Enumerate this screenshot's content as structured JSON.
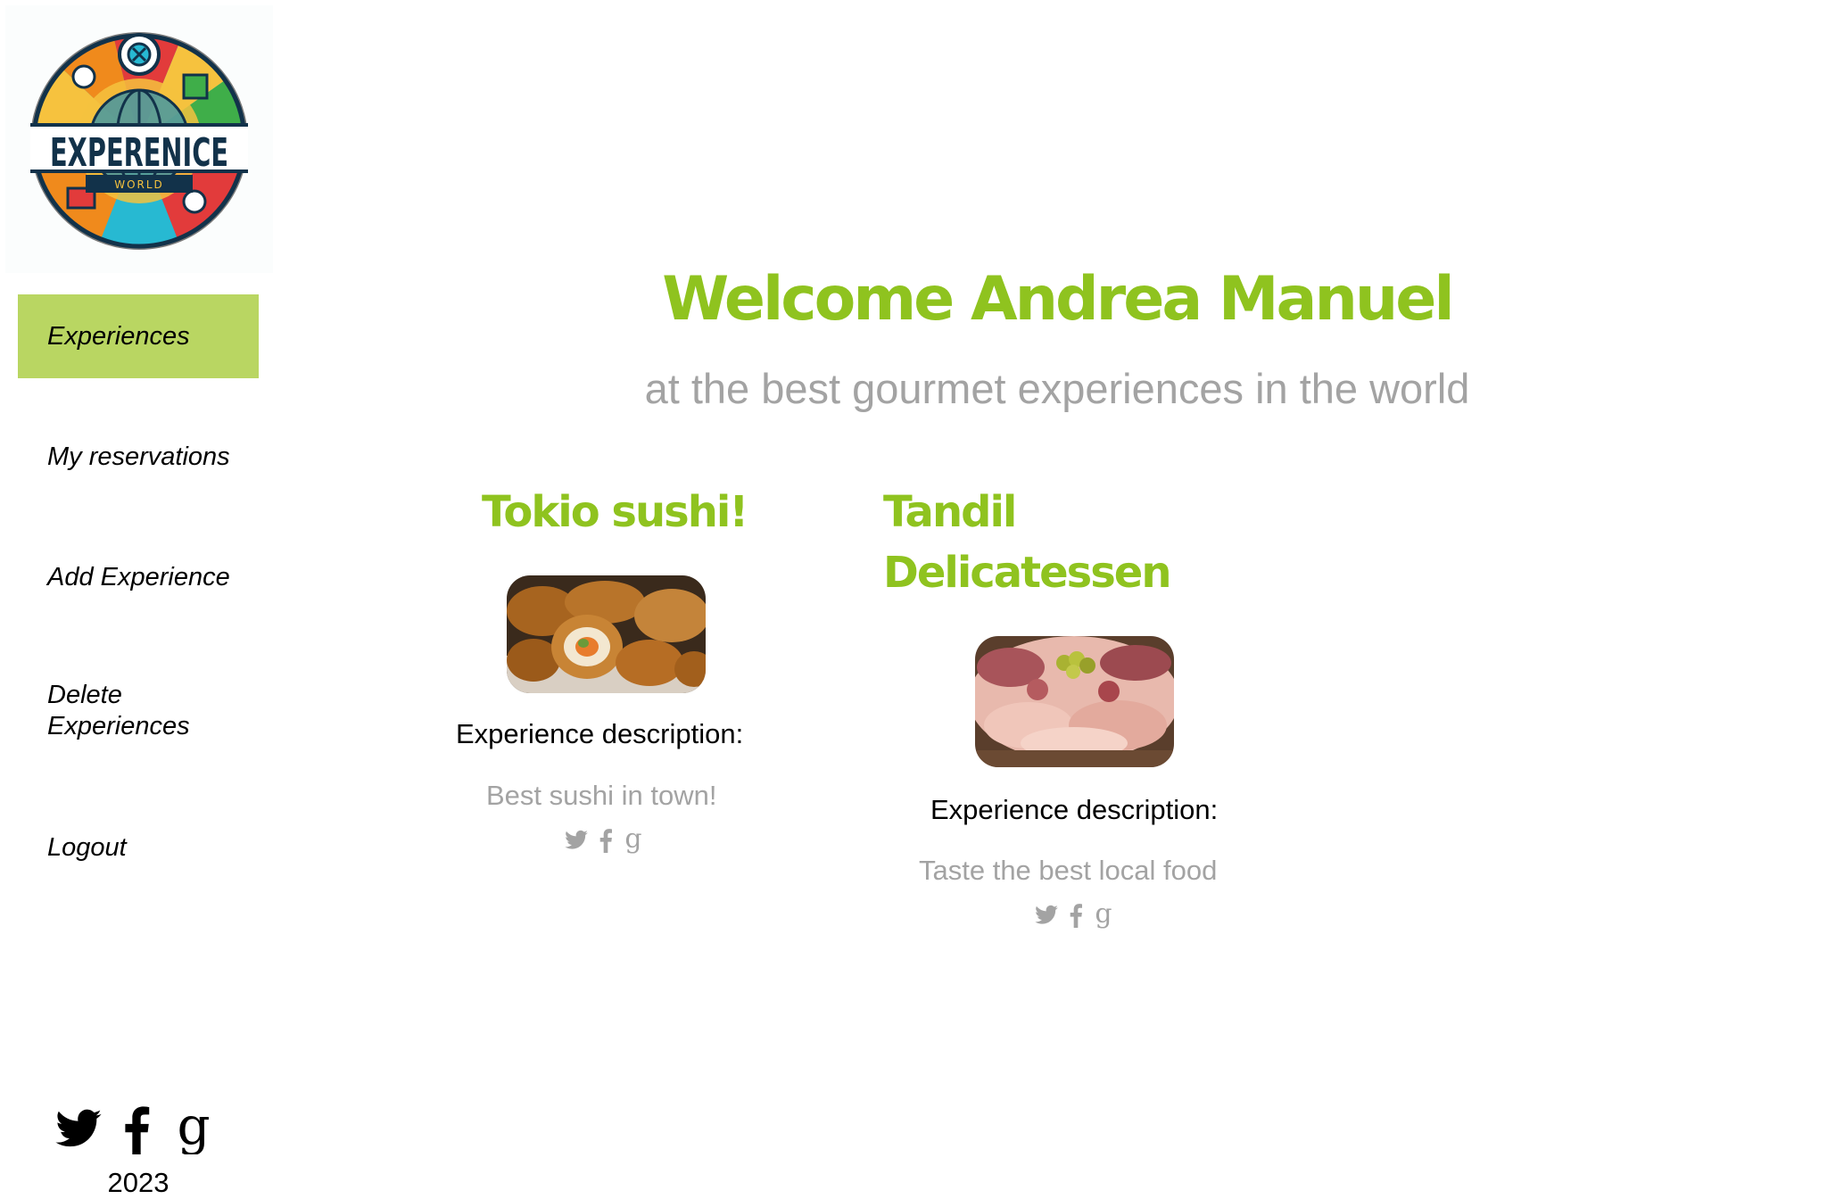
{
  "brand": {
    "logo_text": "EXPERENICE",
    "logo_subtext": "WORLD"
  },
  "sidebar": {
    "items": [
      {
        "label": "Experiences",
        "active": true
      },
      {
        "label": "My reservations",
        "active": false
      },
      {
        "label": "Add Experience",
        "active": false
      },
      {
        "label": "Delete Experiences",
        "active": false
      },
      {
        "label": "Logout",
        "active": false
      }
    ],
    "social_icons": [
      "twitter-icon",
      "facebook-icon",
      "google-icon"
    ],
    "year": "2023"
  },
  "header": {
    "title": "Welcome Andrea Manuel",
    "subtitle": "at the best gourmet experiences in the world"
  },
  "experiences": [
    {
      "title": "Tokio sushi!",
      "image": "sushi-image",
      "description_label": "Experience description:",
      "description": "Best sushi in town!",
      "social_icons": [
        "twitter-icon",
        "facebook-icon",
        "google-icon"
      ]
    },
    {
      "title": "Tandil Delicatessen",
      "image": "delicatessen-image",
      "description_label": "Experience description:",
      "description": "Taste the best local food",
      "social_icons": [
        "twitter-icon",
        "facebook-icon",
        "google-icon"
      ]
    }
  ],
  "colors": {
    "accent": "#8fc31f",
    "nav_active": "#b9d662",
    "muted": "#a3a3a3"
  }
}
